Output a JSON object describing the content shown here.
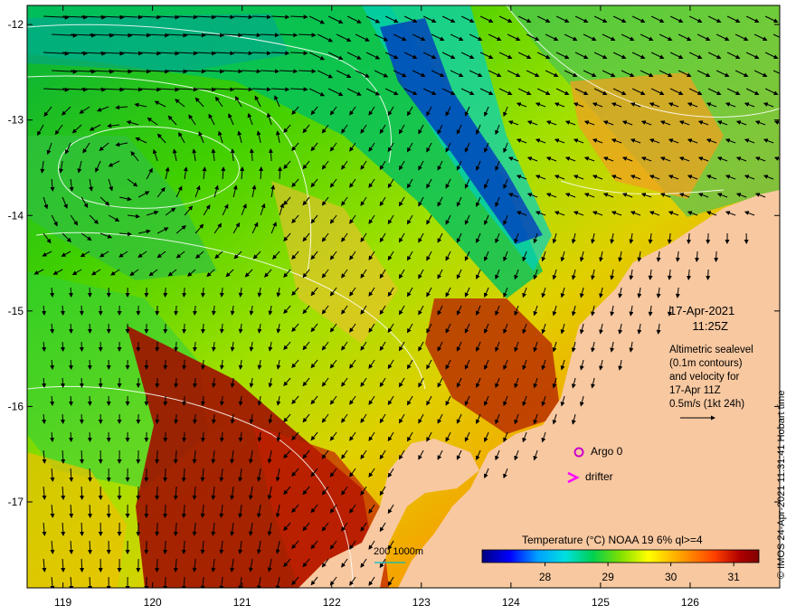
{
  "map": {
    "lat_ticks": [
      "-12",
      "-13",
      "-14",
      "-15",
      "-16",
      "-17"
    ],
    "lon_ticks": [
      "119",
      "120",
      "121",
      "122",
      "123",
      "124",
      "125",
      "126"
    ],
    "lat_range": [
      -17.9,
      -11.8
    ],
    "lon_range": [
      118.6,
      127.0
    ]
  },
  "annotation": {
    "date": "17-Apr-2021",
    "time": "11:25Z",
    "line1": "Altimetric sealevel",
    "line2": "(0.1m contours)",
    "line3": "and velocity for",
    "line4": "17-Apr 11Z",
    "line5": "0.5m/s (1kt 24h)"
  },
  "markers": {
    "argo_label": "Argo 0",
    "drifter_label": "drifter",
    "argo_color": "#cc00cc",
    "drifter_color": "#ff00ff"
  },
  "colorbar": {
    "title": "Temperature (°C) NOAA 19 6% ql>=4",
    "ticks": [
      "28",
      "29",
      "30",
      "31"
    ],
    "colors": [
      "#000080",
      "#0000ff",
      "#00a0ff",
      "#00e0e0",
      "#00d050",
      "#80e000",
      "#ffff00",
      "#ffa000",
      "#ff4000",
      "#b00000",
      "#800000"
    ]
  },
  "scale": {
    "label": "200  1000m"
  },
  "copyright": "© IMOS 24-Apr-2021 11:31:41 Hobart time",
  "colors": {
    "land": "#f8c8a0",
    "contour": "#ffffff",
    "arrow": "#000000"
  }
}
